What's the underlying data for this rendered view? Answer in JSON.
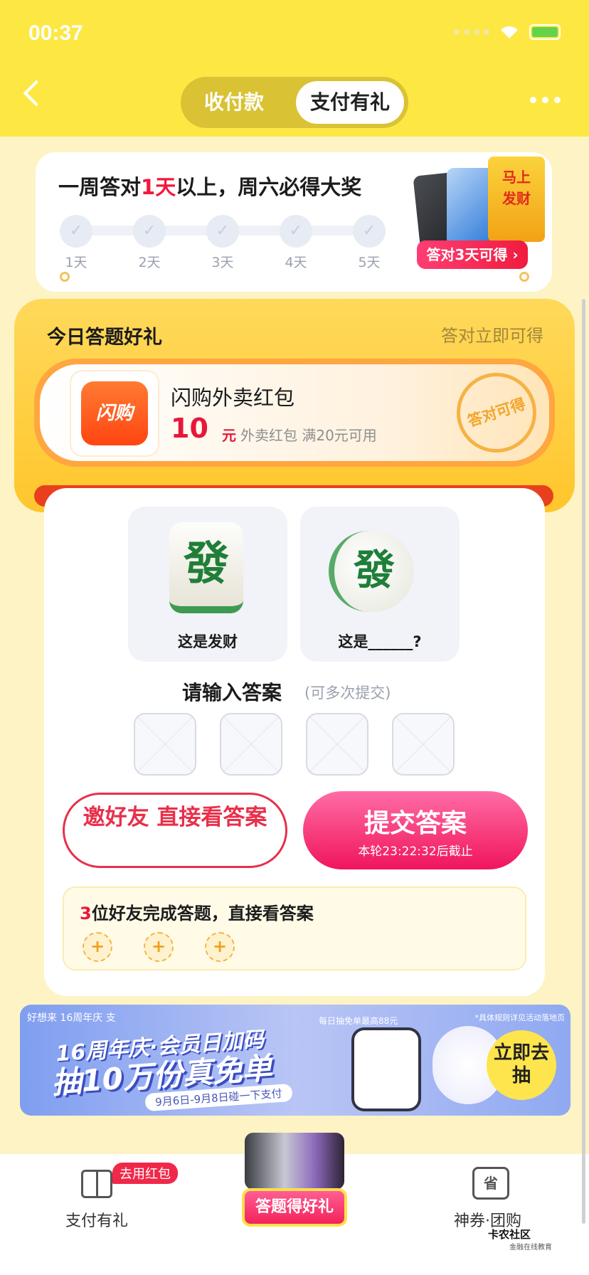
{
  "status": {
    "time": "00:37"
  },
  "segment": {
    "tab1": "收付款",
    "tab2": "支付有礼"
  },
  "week": {
    "title_pre": "一周答对",
    "title_num": "1天",
    "title_post": "以上，周六必得大奖",
    "days": [
      "1天",
      "2天",
      "3天",
      "4天",
      "5天"
    ],
    "prize_envelope": "马上\n发财",
    "prize_tag": "答对3天可得 ›"
  },
  "gift": {
    "title": "今日答题好礼",
    "subtitle": "答对立即可得",
    "brand_logo": "闪购",
    "coupon_name": "闪购外卖红包",
    "coupon_amount": "10",
    "coupon_unit": "元",
    "coupon_desc": "外卖红包 满20元可用",
    "stamp": "答对可得"
  },
  "quiz": {
    "tile_char": "發",
    "coin_char": "發",
    "card1_caption": "这是发财",
    "card2_caption": "这是______?",
    "answer_title": "请输入答案",
    "answer_note": "(可多次提交)",
    "invite_btn": "邀好友 直接看答案",
    "submit_btn": "提交答案",
    "submit_sub": "本轮23:22:32后截止",
    "friend_count": "3",
    "friend_text": "位好友完成答题，直接看答案",
    "plus": "+"
  },
  "banner": {
    "top_brands": "好想来  16周年庆  支",
    "note": "*具体规则详见活动落地页",
    "line1": "16周年庆·会员日加码",
    "line2": "抽10万份真免单",
    "date": "9月6日-9月8日碰一下支付",
    "mid": "每日抽免单最高88元",
    "cta": "立即去抽"
  },
  "nav": {
    "item1": "支付有礼",
    "badge": "去用红包",
    "center": "答题得好礼",
    "item3_icon": "省",
    "item3": "神券·团购"
  },
  "watermark": {
    "name": "卡农社区",
    "sub": "金融在线教育"
  }
}
